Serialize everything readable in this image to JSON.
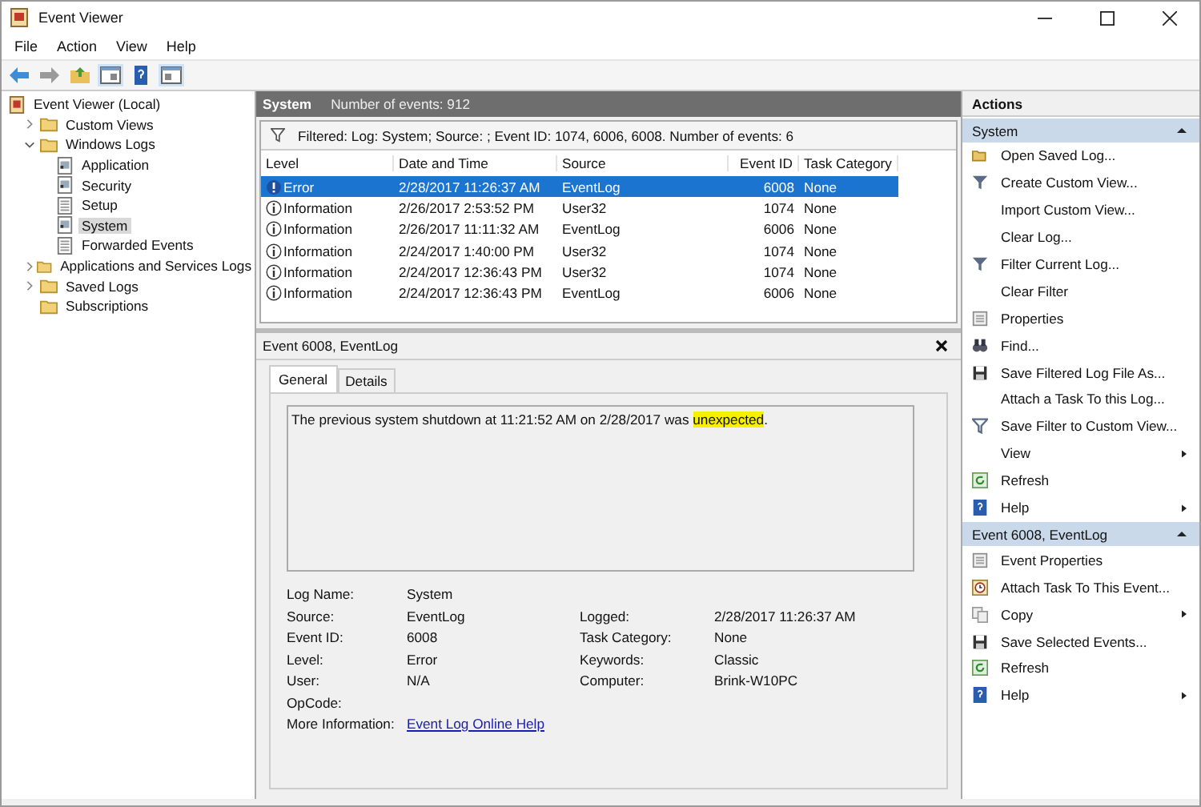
{
  "window": {
    "title": "Event Viewer"
  },
  "menu": [
    "File",
    "Action",
    "View",
    "Help"
  ],
  "tree": [
    {
      "label": "Event Viewer (Local)",
      "kind": "root",
      "selected": false,
      "children": [
        {
          "label": "Custom Views",
          "kind": "folder",
          "expanded": false,
          "selected": false
        },
        {
          "label": "Windows Logs",
          "kind": "folder",
          "expanded": true,
          "selected": false,
          "children": [
            {
              "label": "Application",
              "kind": "log",
              "selected": false
            },
            {
              "label": "Security",
              "kind": "log",
              "selected": false
            },
            {
              "label": "Setup",
              "kind": "page",
              "selected": false
            },
            {
              "label": "System",
              "kind": "log",
              "selected": true
            },
            {
              "label": "Forwarded Events",
              "kind": "page",
              "selected": false
            }
          ]
        },
        {
          "label": "Applications and Services Logs",
          "kind": "folder",
          "expanded": false,
          "selected": false
        },
        {
          "label": "Saved Logs",
          "kind": "folder",
          "expanded": false,
          "selected": false
        },
        {
          "label": "Subscriptions",
          "kind": "folder",
          "selected": false
        }
      ]
    }
  ],
  "log_header": {
    "title": "System",
    "count": "Number of events: 912"
  },
  "filter": "Filtered: Log: System; Source: ; Event ID: 1074, 6006, 6008. Number of events: 6",
  "table": {
    "columns": [
      "Level",
      "Date and Time",
      "Source",
      "Event ID",
      "Task Category"
    ],
    "rows": [
      {
        "kind": "error",
        "level": "Error",
        "date": "2/28/2017 11:26:37 AM",
        "source": "EventLog",
        "event_id": "6008",
        "category": "None",
        "selected": true
      },
      {
        "kind": "information",
        "level": "Information",
        "date": "2/26/2017 2:53:52 PM",
        "source": "User32",
        "event_id": "1074",
        "category": "None",
        "selected": false
      },
      {
        "kind": "information",
        "level": "Information",
        "date": "2/26/2017 11:11:32 AM",
        "source": "EventLog",
        "event_id": "6006",
        "category": "None",
        "selected": false
      },
      {
        "kind": "information",
        "level": "Information",
        "date": "2/24/2017 1:40:00 PM",
        "source": "User32",
        "event_id": "1074",
        "category": "None",
        "selected": false
      },
      {
        "kind": "information",
        "level": "Information",
        "date": "2/24/2017 12:36:43 PM",
        "source": "User32",
        "event_id": "1074",
        "category": "None",
        "selected": false
      },
      {
        "kind": "information",
        "level": "Information",
        "date": "2/24/2017 12:36:43 PM",
        "source": "EventLog",
        "event_id": "6006",
        "category": "None",
        "selected": false
      }
    ]
  },
  "detail": {
    "title": "Event 6008, EventLog",
    "tabs": [
      {
        "label": "General",
        "selected": true
      },
      {
        "label": "Details",
        "selected": false
      }
    ],
    "message": "The previous system shutdown at 11:21:52 AM on 2/28/2017 was ",
    "message_highlight": "unexpected",
    "message_end": ".",
    "field_rows": [
      {
        "left": {
          "label": "Log Name:",
          "value": "System"
        }
      },
      {
        "left": {
          "label": "Source:",
          "value": "EventLog"
        },
        "right": {
          "label": "Logged:",
          "value": "2/28/2017 11:26:37 AM"
        }
      },
      {
        "left": {
          "label": "Event ID:",
          "value": "6008"
        },
        "right": {
          "label": "Task Category:",
          "value": "None"
        }
      },
      {
        "left": {
          "label": "Level:",
          "value": "Error"
        },
        "right": {
          "label": "Keywords:",
          "value": "Classic"
        }
      },
      {
        "left": {
          "label": "User:",
          "value": "N/A"
        },
        "right": {
          "label": "Computer:",
          "value": "Brink-W10PC"
        }
      },
      {
        "left": {
          "label": "OpCode:"
        }
      }
    ],
    "more_info": {
      "label": "More Information:",
      "link": "Event Log Online Help"
    }
  },
  "actions": {
    "title": "Actions",
    "sections": [
      {
        "title": "System",
        "expanded": true,
        "items": [
          {
            "label": "Open Saved Log...",
            "kind": "open",
            "submenu": false
          },
          {
            "label": "Create Custom View...",
            "kind": "funnel",
            "submenu": false
          },
          {
            "label": "Import Custom View...",
            "kind": "none",
            "submenu": false
          },
          {
            "label": "Clear Log...",
            "kind": "none",
            "submenu": false
          },
          {
            "label": "Filter Current Log...",
            "kind": "funnel",
            "submenu": false
          },
          {
            "label": "Clear Filter",
            "kind": "none",
            "submenu": false
          },
          {
            "label": "Properties",
            "kind": "properties",
            "submenu": false
          },
          {
            "label": "Find...",
            "kind": "find",
            "submenu": false
          },
          {
            "label": "Save Filtered Log File As...",
            "kind": "save",
            "submenu": false
          },
          {
            "label": "Attach a Task To this Log...",
            "kind": "none",
            "submenu": false
          },
          {
            "label": "Save Filter to Custom View...",
            "kind": "filter-save",
            "submenu": false
          },
          {
            "label": "View",
            "kind": "none",
            "submenu": true
          },
          {
            "label": "Refresh",
            "kind": "refresh",
            "submenu": false
          },
          {
            "label": "Help",
            "kind": "help",
            "submenu": true
          }
        ]
      },
      {
        "title": "Event 6008, EventLog",
        "expanded": true,
        "items": [
          {
            "label": "Event Properties",
            "kind": "properties",
            "submenu": false
          },
          {
            "label": "Attach Task To This Event...",
            "kind": "task",
            "submenu": false
          },
          {
            "label": "Copy",
            "kind": "copy",
            "submenu": true
          },
          {
            "label": "Save Selected Events...",
            "kind": "save",
            "submenu": false
          },
          {
            "label": "Refresh",
            "kind": "refresh",
            "submenu": false
          },
          {
            "label": "Help",
            "kind": "help",
            "submenu": true
          }
        ]
      }
    ]
  }
}
